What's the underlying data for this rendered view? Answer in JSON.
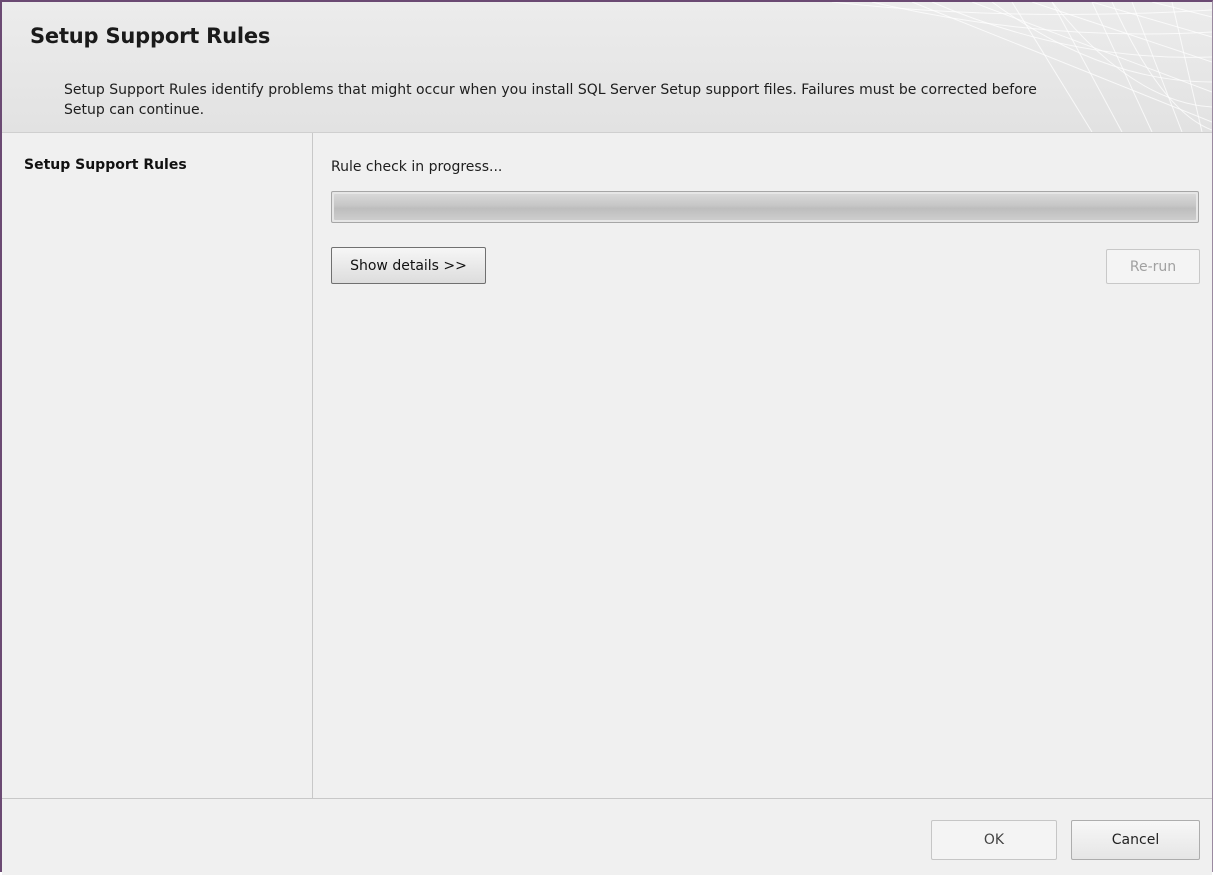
{
  "header": {
    "title": "Setup Support Rules",
    "description": "Setup Support Rules identify problems that might occur when you install SQL Server Setup support files. Failures must be corrected before Setup can continue."
  },
  "nav": {
    "items": [
      {
        "label": "Setup Support Rules",
        "active": true
      }
    ]
  },
  "main": {
    "status_text": "Rule check in progress...",
    "progress_fraction": 1.0,
    "show_details_label": "Show details >>",
    "rerun_label": "Re-run",
    "rerun_enabled": false
  },
  "footer": {
    "ok_label": "OK",
    "ok_enabled": false,
    "cancel_label": "Cancel"
  },
  "colors": {
    "window_border": "#6b4a73",
    "background": "#f0f0f0",
    "disabled_text": "#a0a0a0"
  }
}
